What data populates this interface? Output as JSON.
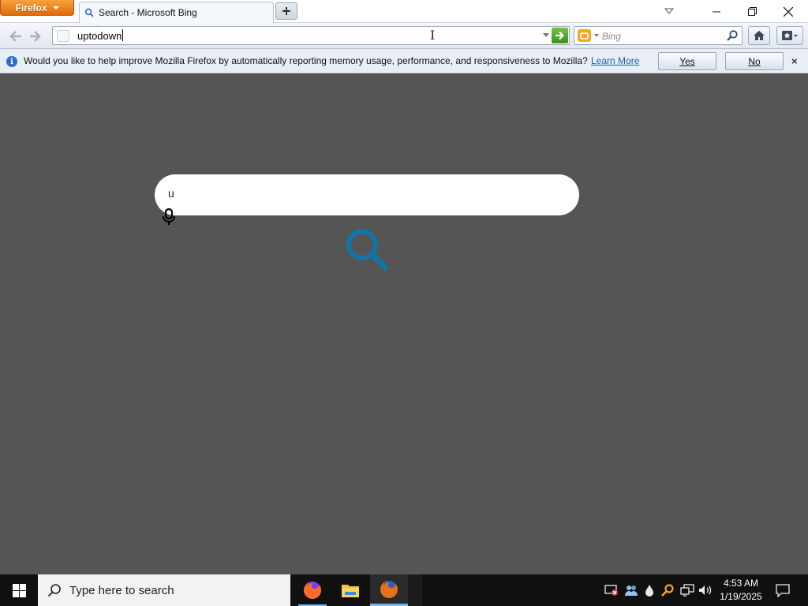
{
  "browser": {
    "menu_label": "Firefox",
    "tab_title": "Search - Microsoft Bing",
    "url": "uptodown",
    "search_engine_placeholder": "Bing"
  },
  "notification": {
    "message": "Would you like to help improve Mozilla Firefox by automatically reporting memory usage, performance, and responsiveness to Mozilla?",
    "link": "Learn More",
    "yes_label": "Yes",
    "no_label": "No",
    "close_glyph": "×"
  },
  "page": {
    "query": "u"
  },
  "taskbar": {
    "search_placeholder": "Type here to search",
    "time": "4:53 AM",
    "date": "1/19/2025"
  },
  "colors": {
    "firefox_orange": "#e16b0b",
    "go_green": "#3e8d21",
    "bing_blue": "#1076a8",
    "page_background": "#555555",
    "taskbar": "#101010"
  }
}
